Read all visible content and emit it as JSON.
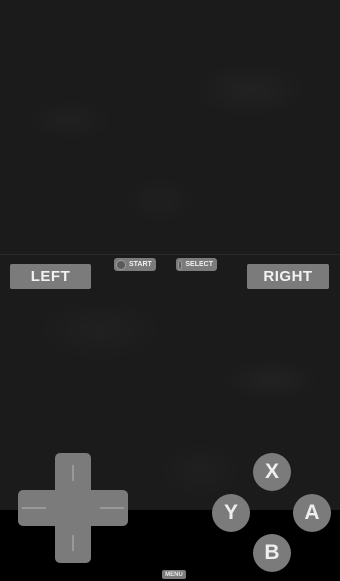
{
  "controls": {
    "shoulder_left": "LEFT",
    "shoulder_right": "RIGHT",
    "start": "START",
    "select": "SELECT",
    "menu": "MENU",
    "face": {
      "x": "X",
      "y": "Y",
      "a": "A",
      "b": "B"
    }
  },
  "icons": {
    "dpad": "dpad-icon",
    "start_dot": "round-button-icon",
    "select_dot": "round-button-icon"
  },
  "colors": {
    "button_fill": "#7b7b7b",
    "button_text": "#f2f2f2",
    "game_background": "#1b1b1b",
    "frame_background": "#000000"
  }
}
